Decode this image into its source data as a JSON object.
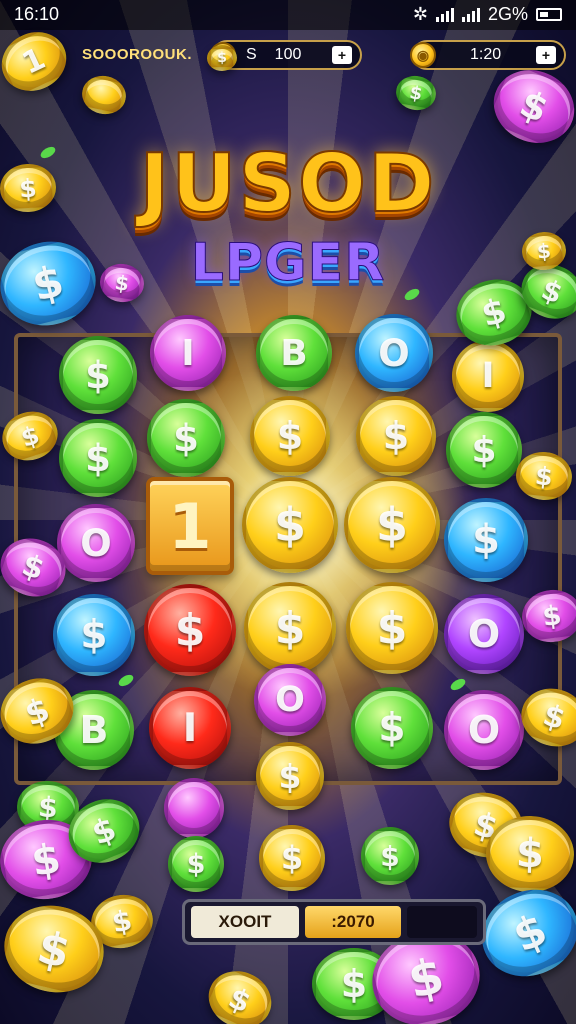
{
  "status_bar": {
    "time": "16:10",
    "indicators": "2G%"
  },
  "hud": {
    "player_name": "SOOOROOUK.",
    "coins": {
      "symbol": "S",
      "value": "100",
      "plus": "+"
    },
    "timer": {
      "value": "1:20",
      "plus": "+"
    }
  },
  "logo": {
    "title": "JUSOD",
    "subtitle": "LPGER"
  },
  "board": {
    "tile_label": "1",
    "coins": [
      {
        "color": "green",
        "glyph": "$"
      },
      {
        "color": "pink",
        "glyph": "I"
      },
      {
        "color": "green",
        "glyph": "B"
      },
      {
        "color": "blue",
        "glyph": "O"
      },
      {
        "color": "gold",
        "glyph": "I"
      },
      {
        "color": "green",
        "glyph": "$"
      },
      {
        "color": "green",
        "glyph": "$"
      },
      {
        "color": "gold",
        "glyph": "$"
      },
      {
        "color": "gold",
        "glyph": "$"
      },
      {
        "color": "green",
        "glyph": "$"
      },
      {
        "color": "pink",
        "glyph": "O"
      },
      {
        "color": "gold",
        "glyph": "$"
      },
      {
        "color": "gold",
        "glyph": "$"
      },
      {
        "color": "blue",
        "glyph": "$"
      },
      {
        "color": "blue",
        "glyph": "$"
      },
      {
        "color": "red",
        "glyph": "$"
      },
      {
        "color": "gold",
        "glyph": "$"
      },
      {
        "color": "gold",
        "glyph": "$"
      },
      {
        "color": "purple",
        "glyph": "O"
      },
      {
        "color": "green",
        "glyph": "B"
      },
      {
        "color": "red",
        "glyph": "I"
      },
      {
        "color": "pink",
        "glyph": "O"
      },
      {
        "color": "green",
        "glyph": "$"
      },
      {
        "color": "pink",
        "glyph": "O"
      },
      {
        "color": "gold",
        "glyph": "$"
      },
      {
        "color": "pink",
        "glyph": ""
      },
      {
        "color": "gold",
        "glyph": "$"
      },
      {
        "color": "green",
        "glyph": "$"
      },
      {
        "color": "green",
        "glyph": "$"
      }
    ]
  },
  "decor_coins": [
    {
      "color": "gold",
      "glyph": "1"
    },
    {
      "color": "gold",
      "glyph": ""
    },
    {
      "color": "gold",
      "glyph": "$"
    },
    {
      "color": "blue",
      "glyph": "$"
    },
    {
      "color": "pink",
      "glyph": "$"
    },
    {
      "color": "green",
      "glyph": "$"
    },
    {
      "color": "gold",
      "glyph": "$"
    },
    {
      "color": "green",
      "glyph": "$"
    },
    {
      "color": "green",
      "glyph": "$"
    },
    {
      "color": "pink",
      "glyph": "$"
    },
    {
      "color": "gold",
      "glyph": "$"
    },
    {
      "color": "gold",
      "glyph": "$"
    },
    {
      "color": "pink",
      "glyph": "$"
    },
    {
      "color": "gold",
      "glyph": "$"
    },
    {
      "color": "pink",
      "glyph": "$"
    },
    {
      "color": "gold",
      "glyph": "$"
    },
    {
      "color": "gold",
      "glyph": "$"
    },
    {
      "color": "green",
      "glyph": "$"
    },
    {
      "color": "pink",
      "glyph": "$"
    },
    {
      "color": "green",
      "glyph": "$"
    },
    {
      "color": "gold",
      "glyph": "$"
    },
    {
      "color": "gold",
      "glyph": "$"
    },
    {
      "color": "gold",
      "glyph": "$"
    },
    {
      "color": "blue",
      "glyph": "$"
    },
    {
      "color": "gold",
      "glyph": "$"
    },
    {
      "color": "green",
      "glyph": "$"
    },
    {
      "color": "pink",
      "glyph": "$"
    },
    {
      "color": "gold",
      "glyph": "$"
    }
  ],
  "bottom_panel": {
    "label": "XOOIT",
    "value": ":2070"
  }
}
